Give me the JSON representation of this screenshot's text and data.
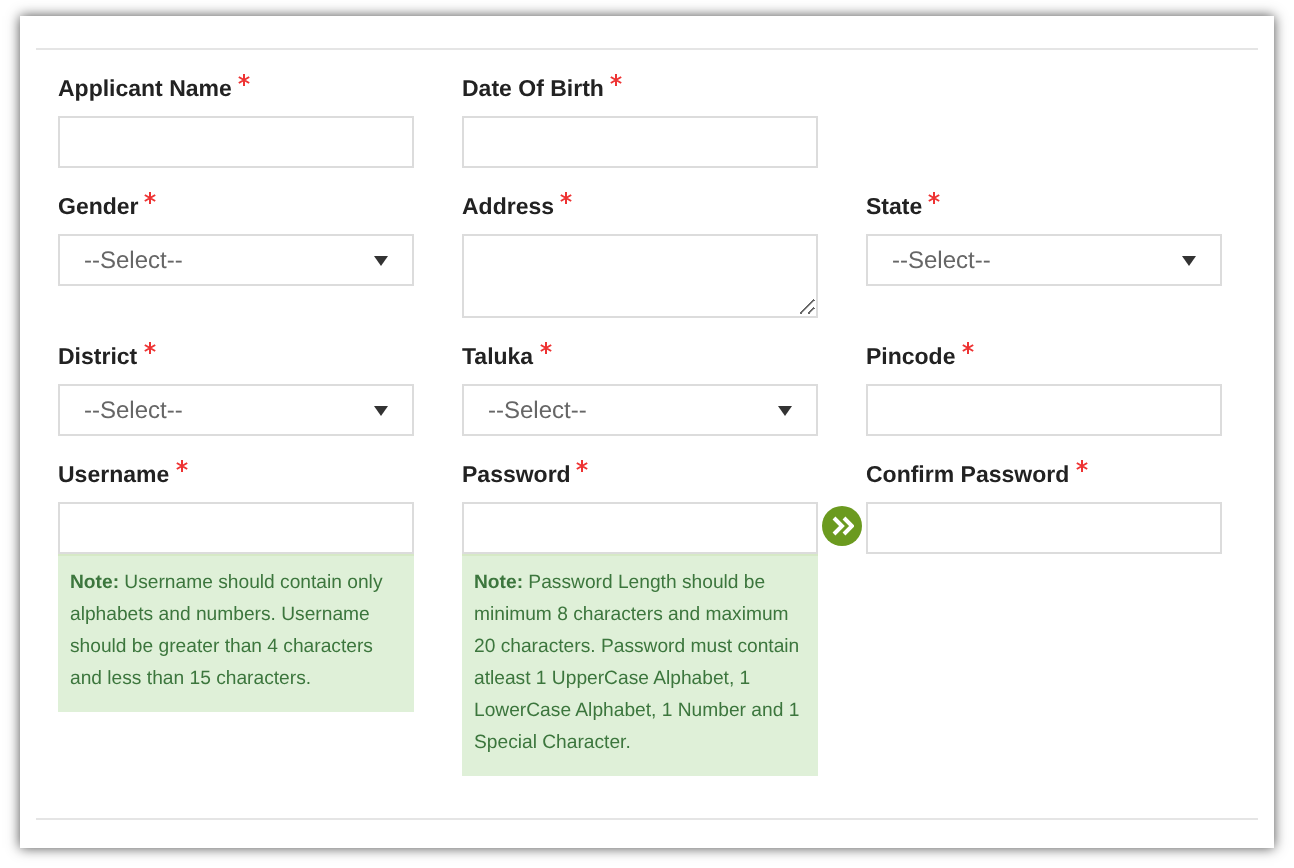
{
  "rows": [
    {
      "fields": [
        {
          "label": "Applicant Name",
          "required": true,
          "kind": "text"
        },
        {
          "label": "Date Of Birth",
          "required": true,
          "kind": "text"
        }
      ]
    },
    {
      "fields": [
        {
          "label": "Gender",
          "required": true,
          "kind": "select",
          "value": "--Select--"
        },
        {
          "label": "Address",
          "required": true,
          "kind": "textarea"
        },
        {
          "label": "State",
          "required": true,
          "kind": "select",
          "value": "--Select--"
        }
      ]
    },
    {
      "fields": [
        {
          "label": "District",
          "required": true,
          "kind": "select",
          "value": "--Select--"
        },
        {
          "label": "Taluka",
          "required": true,
          "kind": "select",
          "value": "--Select--"
        },
        {
          "label": "Pincode",
          "required": true,
          "kind": "text"
        }
      ]
    },
    {
      "fields": [
        {
          "label": "Username",
          "required": true,
          "kind": "text",
          "note": "**Note:** Username should contain only alphabets and numbers. Username should be greater than 4 characters and less than 15 characters."
        },
        {
          "label": "Password",
          "required": true,
          "kind": "text",
          "note": "**Note:** Password Length should be minimum 8 characters and maximum 20 characters. Password must contain atleast 1 UpperCase Alphabet, 1 LowerCase Alphabet, 1 Number and 1 Special Character.",
          "next_button": true
        },
        {
          "label": "Confirm Password",
          "required": true,
          "kind": "text"
        }
      ]
    }
  ]
}
